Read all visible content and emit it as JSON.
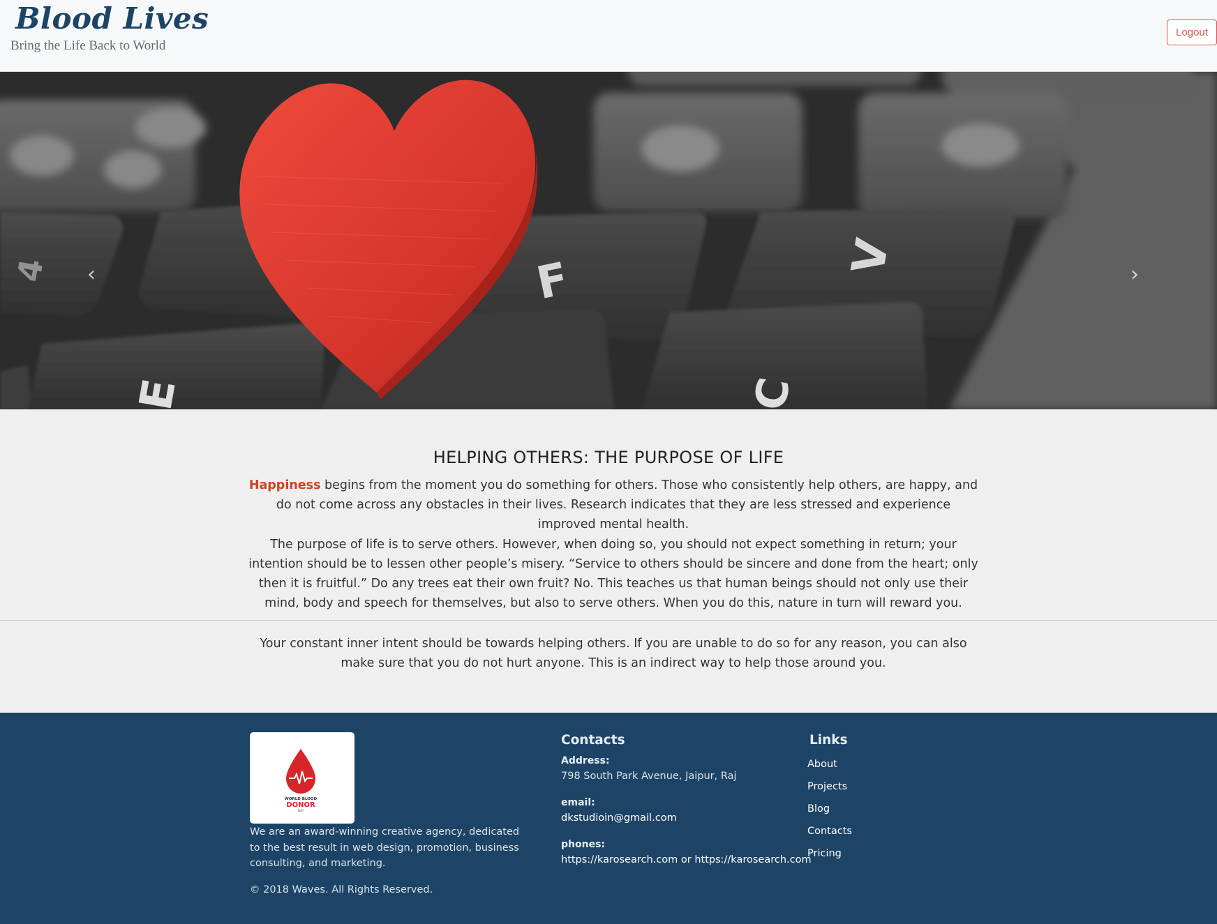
{
  "header": {
    "brand": "Blood Lives",
    "tagline": "Bring the Life Back to World",
    "logout_label": "Logout"
  },
  "carousel": {
    "prev_icon": "chevron-left-icon",
    "next_icon": "chevron-right-icon",
    "prev_glyph": "‹",
    "next_glyph": "›",
    "image_subject": "red-heart-on-keyboard"
  },
  "main": {
    "title": "HELPING OTHERS: THE PURPOSE OF LIFE",
    "p1_highlight": "Happiness",
    "p1_text": " begins from the moment you do something for others. Those who consistently help others, are happy, and do not come across any obstacles in their lives. Research indicates that they are less stressed and experience improved mental health.",
    "p2_text": "The purpose of life is to serve others. However, when doing so, you should not expect something in return; your intention should be to lessen other people’s misery. “Service to others should be sincere and done from the heart; only then it is fruitful.” Do any trees eat their own fruit? No. This teaches us that human beings should not only use their mind, body and speech for themselves, but also to serve others. When you do this, nature in turn will reward you.",
    "p3_text": "Your constant inner intent should be towards helping others. If you are unable to do so for any reason, you can also make sure that you do not hurt anyone. This is an indirect way to help those around you."
  },
  "footer": {
    "logo_text_line1": "WORLD BLOOD",
    "logo_text_line2": "DONOR",
    "logo_text_line3": "DAY",
    "about": "We are an award-winning creative agency, dedicated to the best result in web design, promotion, business consulting, and marketing.",
    "copyright": "©  2018 Waves. All Rights Reserved.",
    "contacts": {
      "title": "Contacts",
      "address_label": "Address:",
      "address": "798 South Park Avenue, Jaipur, Raj",
      "email_label": "email:",
      "email": "dkstudioin@gmail.com",
      "phones_label": "phones:",
      "phone1": "https://karosearch.com",
      "phone_sep": " or ",
      "phone2": "https://karosearch.com"
    },
    "links": {
      "title": "Links",
      "items": [
        "About",
        "Projects",
        "Blog",
        "Contacts",
        "Pricing"
      ]
    }
  },
  "colors": {
    "brand": "#1d4466",
    "accent": "#d1421e",
    "logout": "#d9534f",
    "footer_bg": "#1d4466"
  }
}
